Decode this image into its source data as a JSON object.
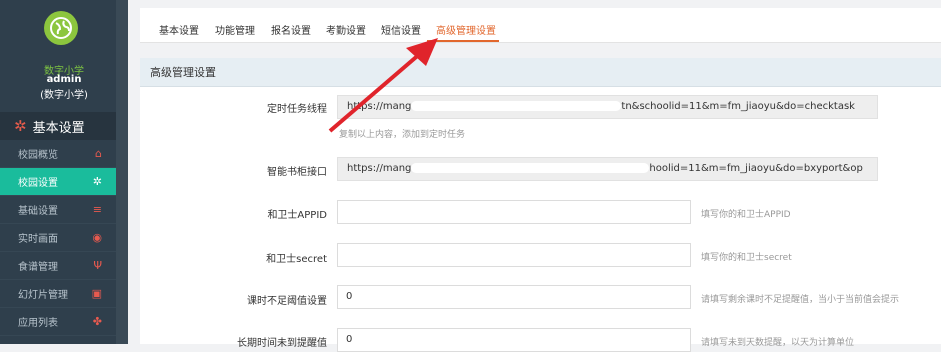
{
  "sidebar": {
    "school_name": "数字小学",
    "user": "admin",
    "user_school": "(数字小学)",
    "section_label": "基本设置",
    "items": [
      {
        "label": "校园概览",
        "icon": "bank-icon",
        "glyph": "🏛"
      },
      {
        "label": "校园设置",
        "icon": "gear-icon",
        "glyph": "✲",
        "active": true
      },
      {
        "label": "基础设置",
        "icon": "list-icon",
        "glyph": "≡"
      },
      {
        "label": "实时画面",
        "icon": "eye-icon",
        "glyph": "◉"
      },
      {
        "label": "食谱管理",
        "icon": "cutlery-icon",
        "glyph": "¥"
      },
      {
        "label": "幻灯片管理",
        "icon": "image-icon",
        "glyph": "▣"
      },
      {
        "label": "应用列表",
        "icon": "apps-icon",
        "glyph": "✤"
      }
    ]
  },
  "tabs": [
    "基本设置",
    "功能管理",
    "报名设置",
    "考勤设置",
    "短信设置",
    "高级管理设置"
  ],
  "active_tab_index": 5,
  "panel": {
    "title": "高级管理设置",
    "fields": [
      {
        "label": "定时任务线程",
        "value_start": "https://mang",
        "value_end": "tn&schoolid=11&m=fm_jiaoyu&do=checktask",
        "help": "复制以上内容，添加到定时任务"
      },
      {
        "label": "智能书柜接口",
        "value_start": "https://mang",
        "value_end": "hoolid=11&m=fm_jiaoyu&do=bxyport&op"
      },
      {
        "label": "和卫士APPID",
        "value": "",
        "help": "填写你的和卫士APPID"
      },
      {
        "label": "和卫士secret",
        "value": "",
        "help": "填写你的和卫士secret"
      },
      {
        "label": "课时不足阈值设置",
        "value": "0",
        "help": "请填写剩余课时不足提醒值，当小于当前值会提示"
      },
      {
        "label": "长期时间未到提醒值",
        "value": "0",
        "help": "请填写未到天数提醒，以天为计算单位"
      }
    ]
  },
  "colors": {
    "accent": "#e2672d",
    "sidebar_bg": "#2f3f4c",
    "active_item": "#1abc9c",
    "arrow": "#e0242b"
  }
}
